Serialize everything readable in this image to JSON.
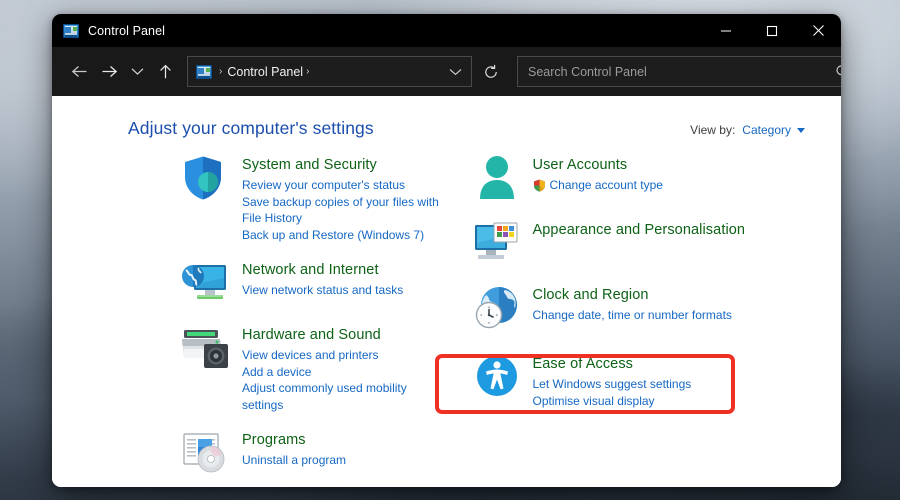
{
  "window": {
    "title": "Control Panel",
    "titlebar_icon": "control-panel-icon",
    "controls": {
      "minimize": "Minimise",
      "maximize": "Maximise",
      "close": "Close"
    }
  },
  "toolbar": {
    "back": "Back",
    "forward": "Forward",
    "recent": "Recent locations",
    "up": "Up",
    "refresh": "Refresh",
    "breadcrumb": {
      "icon": "control-panel-icon",
      "separator_1": "›",
      "label": "Control Panel",
      "separator_2": "›",
      "chevron": "⌄"
    },
    "search": {
      "placeholder": "Search Control Panel",
      "value": "",
      "icon": "search-icon"
    }
  },
  "content": {
    "page_title": "Adjust your computer's settings",
    "view_by": {
      "label": "View by:",
      "value": "Category",
      "arrow": "▾"
    },
    "left_column": [
      {
        "icon": "shield-icon",
        "title": "System and Security",
        "links": [
          "Review your computer's status",
          "Save backup copies of your files with File History",
          "Back up and Restore (Windows 7)"
        ]
      },
      {
        "icon": "network-globe-monitor-icon",
        "title": "Network and Internet",
        "links": [
          "View network status and tasks"
        ]
      },
      {
        "icon": "printer-speaker-icon",
        "title": "Hardware and Sound",
        "links": [
          "View devices and printers",
          "Add a device",
          "Adjust commonly used mobility settings"
        ]
      },
      {
        "icon": "programs-disc-icon",
        "title": "Programs",
        "links": [
          "Uninstall a program"
        ]
      }
    ],
    "right_column": [
      {
        "icon": "user-person-icon",
        "title": "User Accounts",
        "links": [
          "Change account type"
        ],
        "link_badges": [
          "uac-shield-icon"
        ]
      },
      {
        "icon": "appearance-monitor-icon",
        "title": "Appearance and Personalisation",
        "links": []
      },
      {
        "icon": "clock-globe-icon",
        "title": "Clock and Region",
        "links": [
          "Change date, time or number formats"
        ],
        "highlighted": true
      },
      {
        "icon": "ease-of-access-icon",
        "title": "Ease of Access",
        "links": [
          "Let Windows suggest settings",
          "Optimise visual display"
        ]
      }
    ]
  },
  "annotation": {
    "type": "highlight-rectangle",
    "target": "Clock and Region",
    "color": "#ef3124"
  },
  "colors": {
    "titlebar_bg": "#000000",
    "toolbar_bg": "#191919",
    "content_bg": "#ffffff",
    "page_title": "#1b4ead",
    "category_title": "#0e6216",
    "link": "#1668c4",
    "highlight": "#ef3124"
  }
}
